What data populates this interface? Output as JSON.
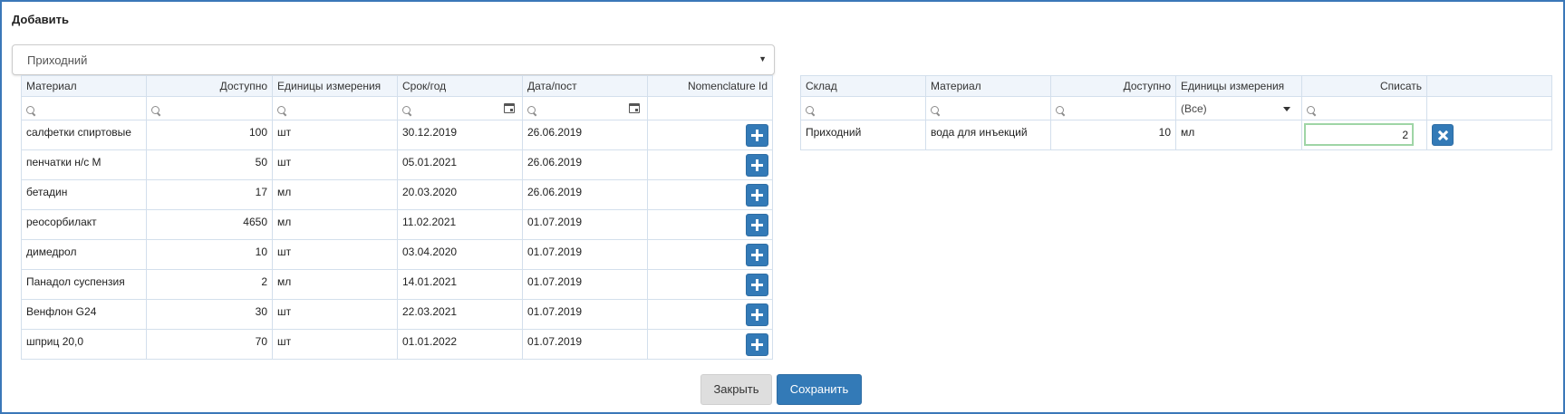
{
  "dialog": {
    "title": "Добавить"
  },
  "warehouse_select": {
    "value": "Приходний"
  },
  "left_table": {
    "headers": {
      "material": "Материал",
      "available": "Доступно",
      "units": "Единицы измерения",
      "expiry": "Срок/год",
      "date": "Дата/пост",
      "nomenclature": "Nomenclature Id"
    },
    "rows": [
      {
        "material": "салфетки спиртовые",
        "available": "100",
        "units": "шт",
        "expiry": "30.12.2019",
        "date": "26.06.2019"
      },
      {
        "material": "пенчатки н/с М",
        "available": "50",
        "units": "шт",
        "expiry": "05.01.2021",
        "date": "26.06.2019"
      },
      {
        "material": "бетадин",
        "available": "17",
        "units": "мл",
        "expiry": "20.03.2020",
        "date": "26.06.2019"
      },
      {
        "material": "реосорбилакт",
        "available": "4650",
        "units": "мл",
        "expiry": "11.02.2021",
        "date": "01.07.2019"
      },
      {
        "material": "димедрол",
        "available": "10",
        "units": "шт",
        "expiry": "03.04.2020",
        "date": "01.07.2019"
      },
      {
        "material": "Панадол суспензия",
        "available": "2",
        "units": "мл",
        "expiry": "14.01.2021",
        "date": "01.07.2019"
      },
      {
        "material": "Венфлон G24",
        "available": "30",
        "units": "шт",
        "expiry": "22.03.2021",
        "date": "01.07.2019"
      },
      {
        "material": "шприц 20,0",
        "available": "70",
        "units": "шт",
        "expiry": "01.01.2022",
        "date": "01.07.2019"
      }
    ]
  },
  "right_table": {
    "headers": {
      "warehouse": "Склад",
      "material": "Материал",
      "available": "Доступно",
      "units": "Единицы измерения",
      "write_off": "Списать"
    },
    "units_filter": "(Все)",
    "rows": [
      {
        "warehouse": "Приходний",
        "material": "вода для инъекций",
        "available": "10",
        "units": "мл",
        "write_off": "2"
      }
    ]
  },
  "buttons": {
    "close": "Закрыть",
    "save": "Сохранить"
  },
  "colors": {
    "accent": "#337ab7",
    "frame": "#3b78b8",
    "header_bg": "#f0f5fb"
  }
}
